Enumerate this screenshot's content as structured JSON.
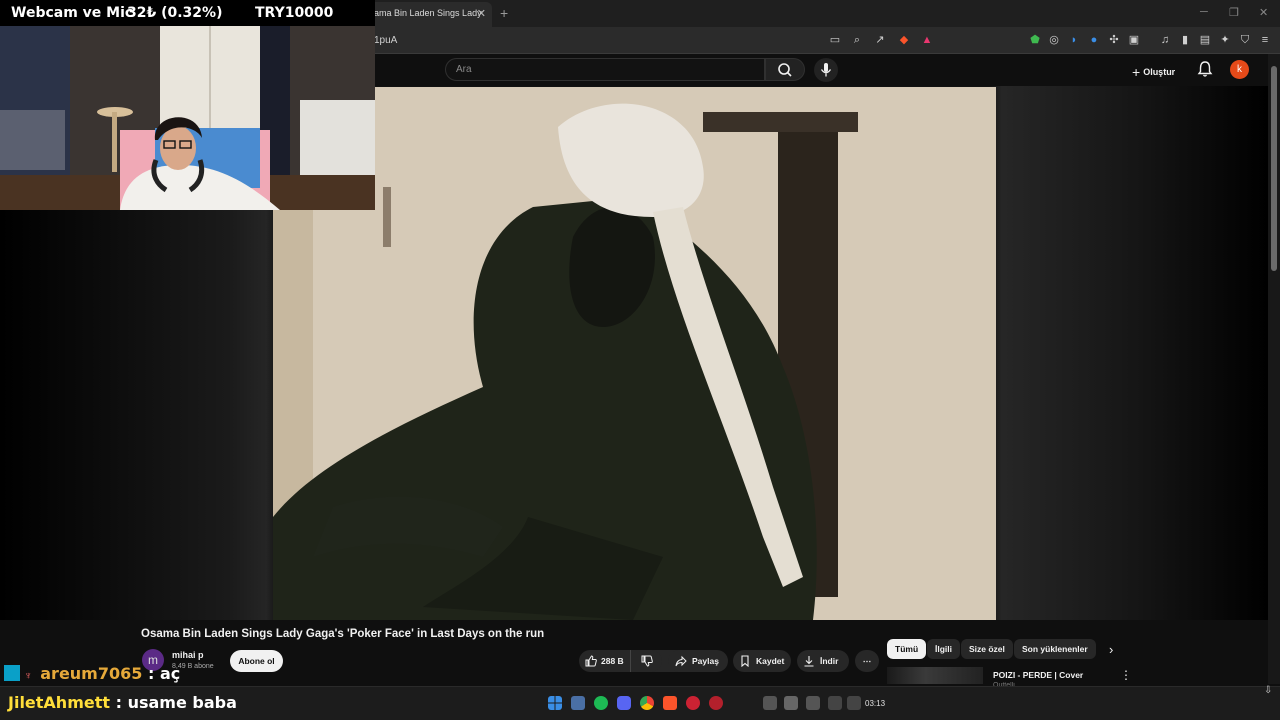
{
  "browser": {
    "tab_title": "ama Bin Laden Sings Lady",
    "url_fragment": "1puA",
    "new_tab_icon": "plus-icon"
  },
  "youtube_header": {
    "search_placeholder": "Ara",
    "create_label": "Oluştur",
    "account_initial": "k"
  },
  "webcam_overlay": {
    "label": "Webcam ve Mic",
    "price": "32₺ (0.32%)",
    "goal": "TRY10000"
  },
  "video": {
    "title": "Osama Bin Laden Sings Lady Gaga's 'Poker Face' in Last Days on the run",
    "channel_initial": "m",
    "channel_name": "mihai p",
    "subscribers": "8,49 B abone",
    "subscribe_label": "Abone ol",
    "likes": "288 B",
    "share_label": "Paylaş",
    "save_label": "Kaydet",
    "download_label": "İndir"
  },
  "filter_chips": [
    "Tümü",
    "İlgili",
    "Size özel",
    "Son yüklenenler"
  ],
  "recommendation": {
    "title": "POIZI - PERDE | Cover",
    "channel": "Outtelli"
  },
  "chat": [
    {
      "user": "areum7065",
      "separator": " : ",
      "message": "aç",
      "user_color": "#e6a93a"
    },
    {
      "user": "JiletAhmett",
      "separator": " : ",
      "message": "usame baba",
      "user_color": "#ffde3a"
    }
  ],
  "taskbar": {
    "time": "03:13"
  },
  "colors": {
    "youtube_bg": "#0f0f0f",
    "accent_red": "#e64a19"
  }
}
